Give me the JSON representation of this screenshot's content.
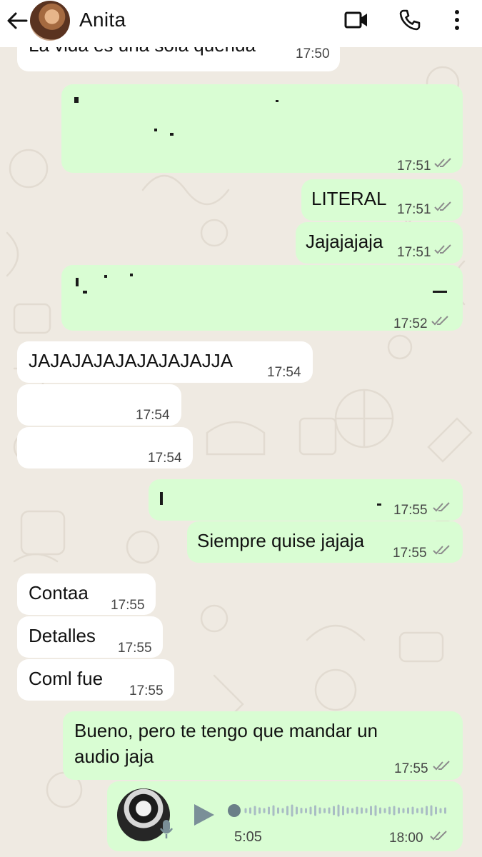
{
  "header": {
    "contact_name": "Anita",
    "icons": [
      "back-arrow-icon",
      "video-call-icon",
      "phone-icon",
      "more-vert-icon"
    ]
  },
  "colors": {
    "outgoing_bubble": "#d9fdd3",
    "incoming_bubble": "#ffffff",
    "chat_background": "#efeae2",
    "read_ticks": "#8c8c8c"
  },
  "messages": [
    {
      "direction": "in",
      "text": "La vida es una sola querida",
      "time": "17:50"
    },
    {
      "direction": "out",
      "text": "",
      "time": "17:51",
      "redacted": true
    },
    {
      "direction": "out",
      "text": "LITERAL",
      "time": "17:51"
    },
    {
      "direction": "out",
      "text": "Jajajajaja",
      "time": "17:51"
    },
    {
      "direction": "out",
      "text": "",
      "time": "17:52",
      "redacted": true
    },
    {
      "direction": "in",
      "text": "JAJAJAJAJAJAJAJAJJA",
      "time": "17:54"
    },
    {
      "direction": "in",
      "text": "",
      "time": "17:54",
      "redacted": true
    },
    {
      "direction": "in",
      "text": "",
      "time": "17:54",
      "redacted": true
    },
    {
      "direction": "out",
      "text": "",
      "time": "17:55",
      "redacted": true
    },
    {
      "direction": "out",
      "text": "Siempre quise jajaja",
      "time": "17:55"
    },
    {
      "direction": "in",
      "text": "Contaa",
      "time": "17:55"
    },
    {
      "direction": "in",
      "text": "Detalles",
      "time": "17:55"
    },
    {
      "direction": "in",
      "text": "Coml fue",
      "time": "17:55"
    },
    {
      "direction": "out",
      "text_line1": "Bueno, pero te tengo que mandar un",
      "text_line2": "audio jaja",
      "time": "17:55"
    },
    {
      "direction": "out",
      "type": "audio",
      "duration": "5:05",
      "time": "18:00"
    }
  ]
}
